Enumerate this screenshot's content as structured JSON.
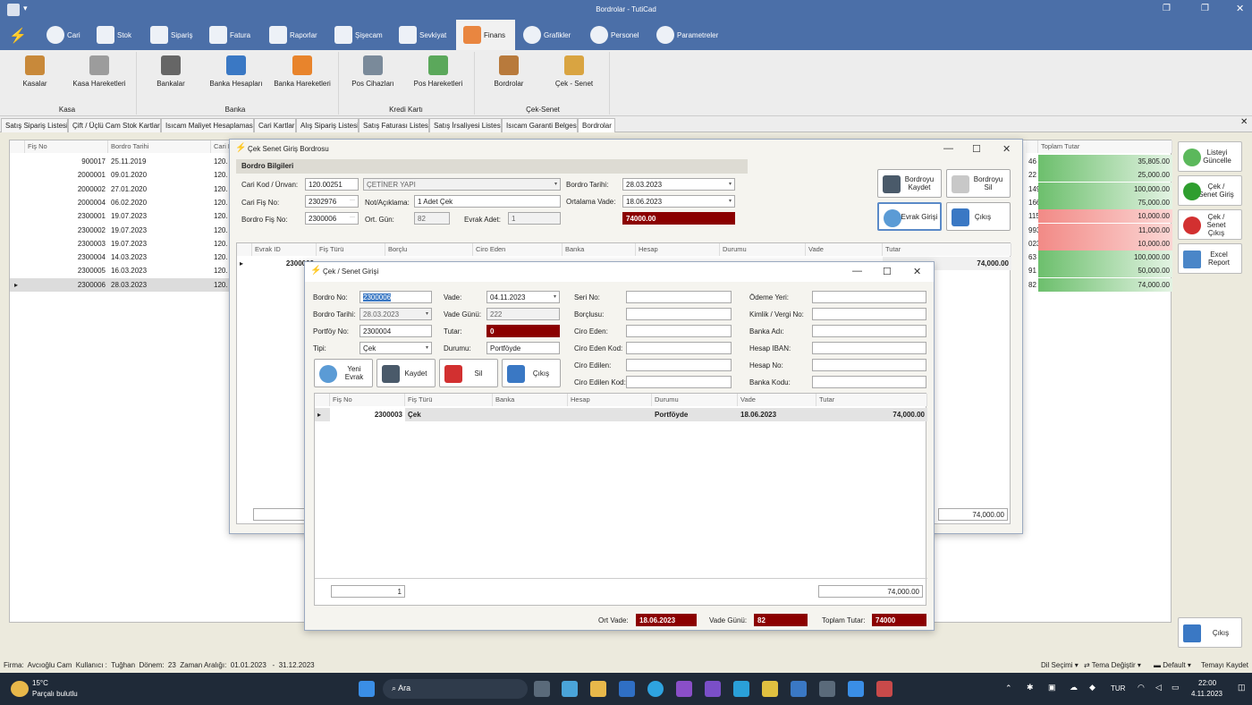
{
  "app": {
    "title": "Bordrolar - TutiCad"
  },
  "menu": [
    "Cari",
    "Stok",
    "Sipariş",
    "Fatura",
    "Raporlar",
    "Şişecam",
    "Sevkiyat",
    "Finans",
    "Grafikler",
    "Personel",
    "Parametreler"
  ],
  "ribbon": {
    "buttons": [
      "Kasalar",
      "Kasa Hareketleri",
      "Bankalar",
      "Banka Hesapları",
      "Banka Hareketleri",
      "Pos Cihazları",
      "Pos Hareketleri",
      "Bordrolar",
      "Çek - Senet"
    ],
    "groups": [
      "Kasa",
      "Banka",
      "Kredi Kartı",
      "Çek-Senet"
    ]
  },
  "tabs": [
    "Satış Sipariş Listesi",
    "Çift / Üçlü Cam Stok Kartları",
    "Isıcam Maliyet Hesaplaması",
    "Cari Kartlar",
    "Alış Sipariş Listesi",
    "Satış Faturası Listesi",
    "Satış İrsaliyesi Listesi",
    "Isıcam Garanti Belgesi",
    "Bordrolar"
  ],
  "main_grid": {
    "headers": [
      "Fiş No",
      "Bordro Tarihi",
      "Cari K"
    ],
    "total_header": "Toplam Tutar",
    "rows": [
      {
        "fis": "900017",
        "tarih": "25.11.2019",
        "cari": "120.",
        "n": "46",
        "tutar": "35,805.00",
        "tone": "green"
      },
      {
        "fis": "2000001",
        "tarih": "09.01.2020",
        "cari": "120.",
        "n": "22",
        "tutar": "25,000.00",
        "tone": "green"
      },
      {
        "fis": "2000002",
        "tarih": "27.01.2020",
        "cari": "120.",
        "n": "149",
        "tutar": "100,000.00",
        "tone": "green"
      },
      {
        "fis": "2000004",
        "tarih": "06.02.2020",
        "cari": "120.",
        "n": "166",
        "tutar": "75,000.00",
        "tone": "green"
      },
      {
        "fis": "2300001",
        "tarih": "19.07.2023",
        "cari": "120.",
        "n": "115",
        "tutar": "10,000.00",
        "tone": "red"
      },
      {
        "fis": "2300002",
        "tarih": "19.07.2023",
        "cari": "120.",
        "n": "993",
        "tutar": "11,000.00",
        "tone": "red"
      },
      {
        "fis": "2300003",
        "tarih": "19.07.2023",
        "cari": "120.",
        "n": "023",
        "tutar": "10,000.00",
        "tone": "red"
      },
      {
        "fis": "2300004",
        "tarih": "14.03.2023",
        "cari": "120.",
        "n": "63",
        "tutar": "100,000.00",
        "tone": "green"
      },
      {
        "fis": "2300005",
        "tarih": "16.03.2023",
        "cari": "120.",
        "n": "91",
        "tutar": "50,000.00",
        "tone": "green"
      },
      {
        "fis": "2300006",
        "tarih": "28.03.2023",
        "cari": "120.",
        "n": "82",
        "tutar": "74,000.00",
        "tone": "green"
      }
    ]
  },
  "right_buttons": [
    "Listeyi Güncelle",
    "Çek / Senet Giriş",
    "Çek / Senet Çıkış",
    "Excel Report",
    "Çıkış"
  ],
  "bordro_win": {
    "title": "Çek Senet Giriş Bordrosu",
    "section": "Bordro Bilgileri",
    "labels": {
      "cari": "Cari Kod / Ünvan:",
      "carifis": "Cari Fiş No:",
      "bordrofis": "Bordro Fiş No:",
      "not": "Not/Açıklama:",
      "ortgun": "Ort. Gün:",
      "evrak": "Evrak Adet:",
      "tarih": "Bordro Tarihi:",
      "vade": "Ortalama Vade:"
    },
    "values": {
      "cari_kod": "120.00251",
      "cari_unvan": "ÇETİNER YAPI",
      "cari_fis": "2302976",
      "bordro_fis": "2300006",
      "not": "1 Adet Çek",
      "ortgun": "82",
      "evrak": "1",
      "tarih": "28.03.2023",
      "vade": "18.06.2023",
      "total": "74000.00"
    },
    "buttons": [
      "Bordroyu Kaydet",
      "Bordroyu Sil",
      "Evrak Girişi",
      "Çıkış"
    ],
    "grid_headers": [
      "Evrak ID",
      "Fiş Türü",
      "Borçlu",
      "Ciro Eden",
      "Banka",
      "Hesap",
      "Durumu",
      "Vade",
      "Tutar"
    ],
    "row": {
      "id": "2300003",
      "tutar": "74,000.00"
    },
    "footer_total": "74,000.00"
  },
  "cek_win": {
    "title": "Çek / Senet Girişi",
    "labels": {
      "bordro": "Bordro No:",
      "tarih": "Bordro Tarihi:",
      "portfoy": "Portföy No:",
      "tipi": "Tipi:",
      "vade": "Vade:",
      "vadegun": "Vade Günü:",
      "tutar": "Tutar:",
      "durum": "Durumu:",
      "seri": "Seri No:",
      "borclu": "Borçlusu:",
      "ciroeden": "Ciro Eden:",
      "ciroedenkod": "Ciro Eden Kod:",
      "ciroedilen": "Ciro Edilen:",
      "ciroedilenkod": "Ciro Edilen Kod:",
      "odeme": "Ödeme Yeri:",
      "kimlik": "Kimlik / Vergi No:",
      "bankaadi": "Banka Adı:",
      "iban": "Hesap IBAN:",
      "hesapno": "Hesap No:",
      "bankakodu": "Banka Kodu:"
    },
    "values": {
      "bordro": "2300006",
      "tarih": "28.03.2023",
      "portfoy": "2300004",
      "tipi": "Çek",
      "vade": "04.11.2023",
      "vadegun": "222",
      "tutar": "0",
      "durum": "Portföyde"
    },
    "buttons": [
      "Yeni Evrak",
      "Kaydet",
      "Sil",
      "Çıkış"
    ],
    "grid_headers": [
      "Fiş No",
      "Fiş Türü",
      "Banka",
      "Hesap",
      "Durumu",
      "Vade",
      "Tutar"
    ],
    "row": {
      "fis": "2300003",
      "tur": "Çek",
      "durum": "Portföyde",
      "vade": "18.06.2023",
      "tutar": "74,000.00"
    },
    "footer_count": "1",
    "footer_total": "74,000.00",
    "summary": {
      "ortvade_label": "Ort Vade:",
      "ortvade": "18.06.2023",
      "vadegun_label": "Vade Günü:",
      "vadegun": "82",
      "toplam_label": "Toplam Tutar:",
      "toplam": "74000"
    }
  },
  "statusbar": {
    "left": "Firma:  Avcıoğlu Cam  Kullanıcı :  Tuğhan  Dönem:  23  Zaman Aralığı:  01.01.2023   -  31.12.2023",
    "dil": "Dil Seçimi",
    "tema": "Tema Değiştir",
    "default": "Default",
    "kaydet": "Temayı Kaydet"
  },
  "taskbar": {
    "temp": "15°C",
    "weather": "Parçalı bulutlu",
    "search": "Ara",
    "lang": "TUR",
    "time": "22:00",
    "date": "4.11.2023"
  },
  "colors": {
    "header": "#4B6FA8",
    "green": "#3DAA3D",
    "red": "#F08080",
    "darkred": "#8B0000"
  }
}
